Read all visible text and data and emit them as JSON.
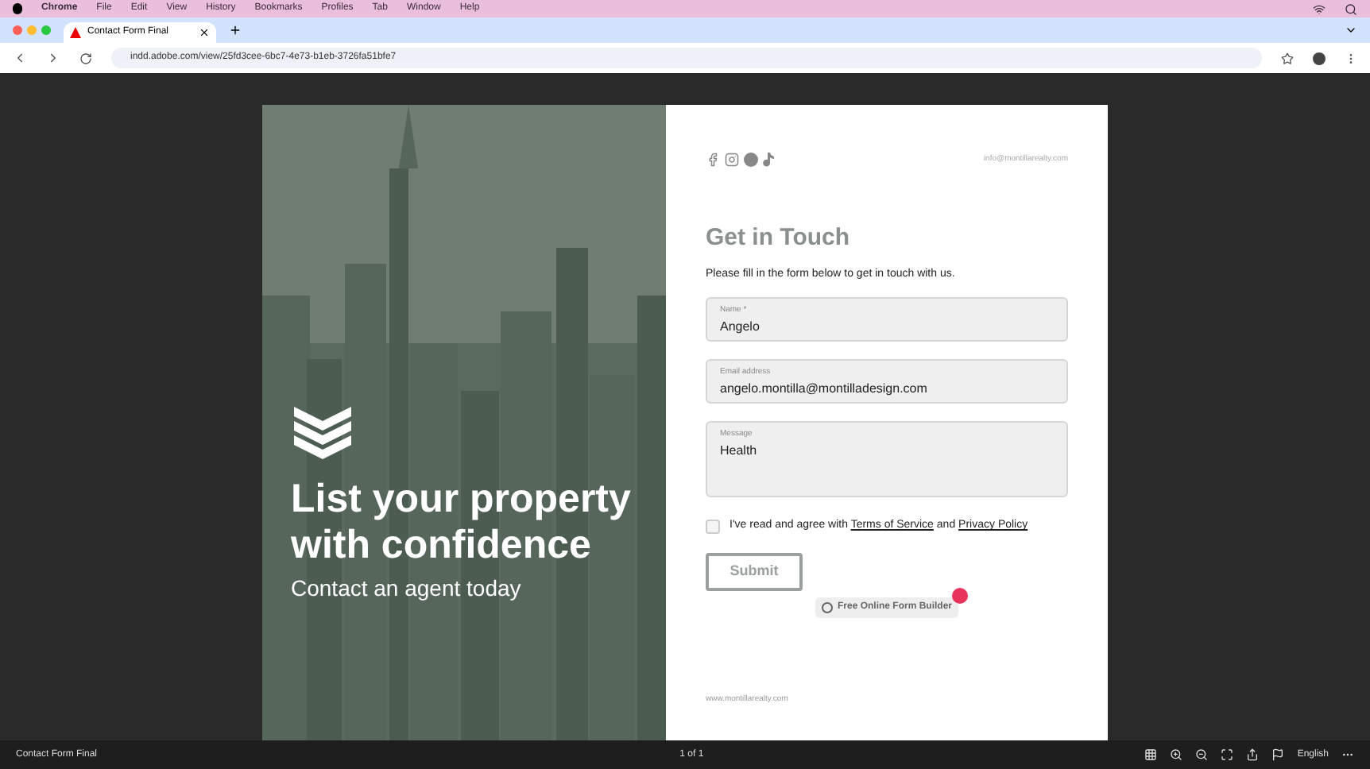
{
  "menu_bar": {
    "app": "Chrome",
    "items": [
      "File",
      "Edit",
      "View",
      "History",
      "Bookmarks",
      "Profiles",
      "Tab",
      "Window",
      "Help"
    ]
  },
  "browser": {
    "tab": {
      "title": "Contact Form Final",
      "selected": true
    },
    "url": "indd.adobe.com/view/25fd3cee-6bc7-4e73-b1eb-3726fa51bfe7"
  },
  "hero": {
    "headline": "List your property with confidence",
    "subline": "Contact an agent today"
  },
  "form": {
    "email_top": "info@montillarealty.com",
    "title": "Get in Touch",
    "intro": "Please fill in the form below to get in touch with us.",
    "fields": [
      {
        "label": "Name *",
        "value": "Angelo",
        "kind": "input"
      },
      {
        "label": "Email address",
        "value": "angelo.montilla@montilladesign.com",
        "kind": "input"
      },
      {
        "label": "Message",
        "value": "Health",
        "kind": "textarea"
      }
    ],
    "consent": {
      "checked": false,
      "before": "I've read and agree with",
      "terms": "Terms of Service",
      "and": "and",
      "privacy": "Privacy Policy"
    },
    "submit": "Submit",
    "builder_badge": "Free Online Form Builder",
    "footer": "www.montillarealty.com"
  },
  "status_bar": {
    "title": "Contact Form Final",
    "pages": "1 of 1",
    "language": "English"
  }
}
